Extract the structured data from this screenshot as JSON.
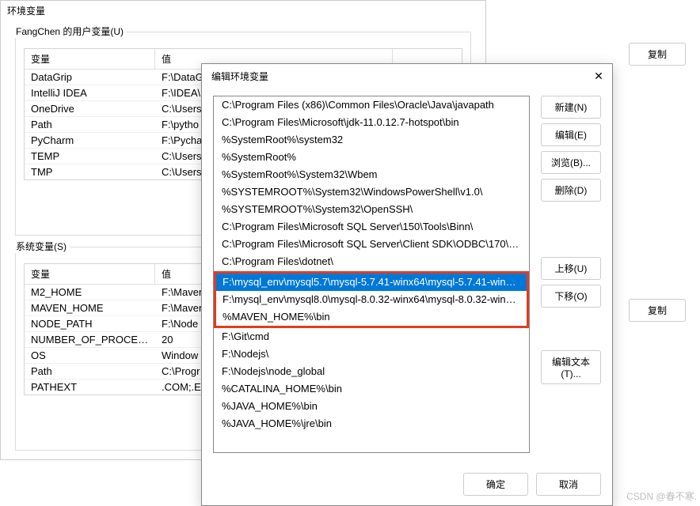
{
  "dialog1": {
    "title": "环境变量",
    "user_vars_label": "FangChen 的用户变量(U)",
    "sys_vars_label": "系统变量(S)",
    "col_var": "变量",
    "col_val": "值",
    "user_rows": [
      {
        "name": "DataGrip",
        "value": "F:\\DataGr"
      },
      {
        "name": "IntelliJ IDEA",
        "value": "F:\\IDEA\\"
      },
      {
        "name": "OneDrive",
        "value": "C:\\Users"
      },
      {
        "name": "Path",
        "value": "F:\\pytho"
      },
      {
        "name": "PyCharm",
        "value": "F:\\Pycha"
      },
      {
        "name": "TEMP",
        "value": "C:\\Users"
      },
      {
        "name": "TMP",
        "value": "C:\\Users"
      }
    ],
    "sys_rows": [
      {
        "name": "M2_HOME",
        "value": "F:\\Maven"
      },
      {
        "name": "MAVEN_HOME",
        "value": "F:\\Maven"
      },
      {
        "name": "NODE_PATH",
        "value": "F:\\Node"
      },
      {
        "name": "NUMBER_OF_PROCESSORS",
        "value": "20"
      },
      {
        "name": "OS",
        "value": "Window"
      },
      {
        "name": "Path",
        "value": "C:\\Progr"
      },
      {
        "name": "PATHEXT",
        "value": ".COM;.E"
      }
    ]
  },
  "dialog2": {
    "title": "编辑环境变量",
    "close": "✕",
    "list": [
      "C:\\Program Files (x86)\\Common Files\\Oracle\\Java\\javapath",
      "C:\\Program Files\\Microsoft\\jdk-11.0.12.7-hotspot\\bin",
      "%SystemRoot%\\system32",
      "%SystemRoot%",
      "%SystemRoot%\\System32\\Wbem",
      "%SYSTEMROOT%\\System32\\WindowsPowerShell\\v1.0\\",
      "%SYSTEMROOT%\\System32\\OpenSSH\\",
      "C:\\Program Files\\Microsoft SQL Server\\150\\Tools\\Binn\\",
      "C:\\Program Files\\Microsoft SQL Server\\Client SDK\\ODBC\\170\\T...",
      "C:\\Program Files\\dotnet\\"
    ],
    "highlighted": [
      "F:\\mysql_env\\mysql5.7\\mysql-5.7.41-winx64\\mysql-5.7.41-winx6...",
      "F:\\mysql_env\\mysql8.0\\mysql-8.0.32-winx64\\mysql-8.0.32-winx6...",
      "%MAVEN_HOME%\\bin"
    ],
    "list_after": [
      "F:\\Git\\cmd",
      "F:\\Nodejs\\",
      "F:\\Nodejs\\node_global",
      "%CATALINA_HOME%\\bin",
      "%JAVA_HOME%\\bin",
      "%JAVA_HOME%\\jre\\bin"
    ],
    "buttons": {
      "new": "新建(N)",
      "edit": "编辑(E)",
      "browse": "浏览(B)...",
      "delete": "删除(D)",
      "up": "上移(U)",
      "down": "下移(O)",
      "edit_text": "编辑文本(T)...",
      "ok": "确定",
      "cancel": "取消"
    }
  },
  "side": {
    "copy": "复制"
  },
  "watermark": "CSDN @春不寒."
}
